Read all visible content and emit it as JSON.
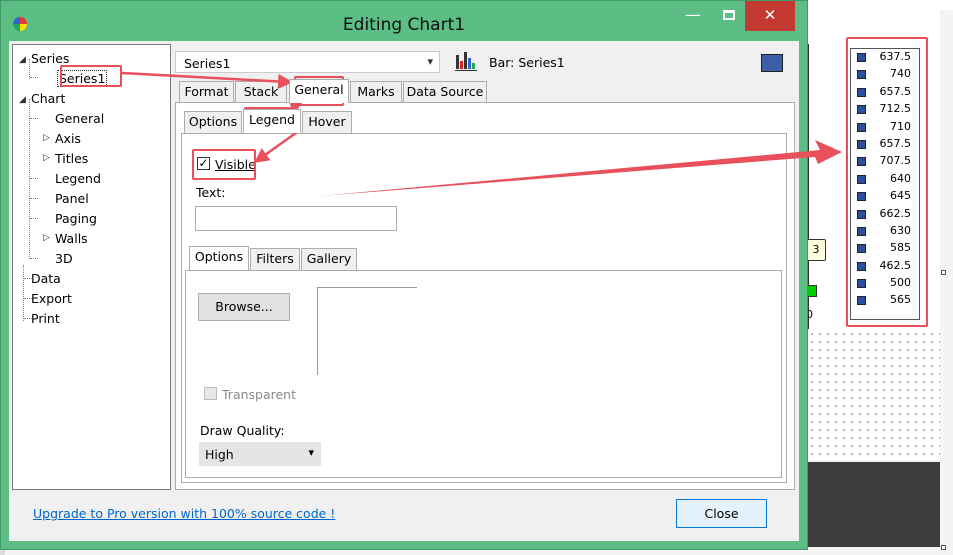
{
  "window": {
    "title": "Editing Chart1",
    "minimize_glyph": "—",
    "close_glyph": "✕"
  },
  "tree": {
    "items": [
      {
        "label": "Series",
        "expanded": true
      },
      {
        "label": "Series1",
        "selected": true
      },
      {
        "label": "Chart",
        "expanded": true
      },
      {
        "label": "General"
      },
      {
        "label": "Axis"
      },
      {
        "label": "Titles"
      },
      {
        "label": "Legend"
      },
      {
        "label": "Panel"
      },
      {
        "label": "Paging"
      },
      {
        "label": "Walls"
      },
      {
        "label": "3D"
      },
      {
        "label": "Data"
      },
      {
        "label": "Export"
      },
      {
        "label": "Print"
      }
    ]
  },
  "series_combo": {
    "value": "Series1"
  },
  "series_title": "Bar: Series1",
  "series_color": "#3c5fa7",
  "tabs_top": [
    "Format",
    "Stack",
    "General",
    "Marks",
    "Data Source"
  ],
  "tabs_second": [
    "Options",
    "Legend",
    "Hover"
  ],
  "legend_tab": {
    "visible_label": "Visible",
    "visible_checked": true,
    "text_label": "Text:",
    "text_value": ""
  },
  "tabs_inner": [
    "Options",
    "Filters",
    "Gallery"
  ],
  "inner_options": {
    "browse_label": "Browse...",
    "transparent_label": "Transparent",
    "transparent_checked": false,
    "draw_quality_label": "Draw Quality:",
    "draw_quality_value": "High"
  },
  "footer": {
    "upgrade_link": "Upgrade to Pro version with 100% source code !",
    "close_label": "Close"
  },
  "chart_preview": {
    "tooltip_value": "3",
    "axis_label": "0"
  },
  "legend_values": [
    "637.5",
    "740",
    "657.5",
    "712.5",
    "710",
    "657.5",
    "707.5",
    "640",
    "645",
    "662.5",
    "630",
    "585",
    "462.5",
    "500",
    "565"
  ],
  "colors": {
    "accent_window": "#5cbd85",
    "annotation": "#e8505b",
    "series_swatch": "#2c4f9c"
  }
}
